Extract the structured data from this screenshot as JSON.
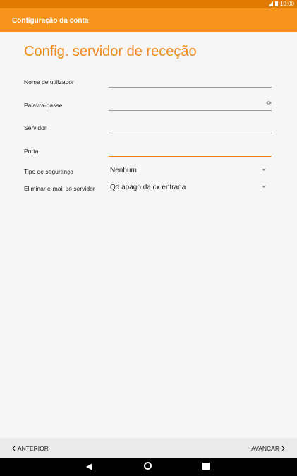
{
  "status": {
    "time": "10:00"
  },
  "app_bar": {
    "title": "Configuração da conta"
  },
  "page": {
    "heading": "Config. servidor de receção"
  },
  "form": {
    "username": {
      "label": "Nome de utilizador",
      "value": ""
    },
    "password": {
      "label": "Palavra-passe",
      "value": ""
    },
    "server": {
      "label": "Servidor",
      "value": ""
    },
    "port": {
      "label": "Porta",
      "value": ""
    },
    "security": {
      "label": "Tipo de segurança",
      "value": "Nenhum"
    },
    "delete_email": {
      "label": "Eliminar e-mail do servidor",
      "value": "Qd apago da cx entrada"
    }
  },
  "footer": {
    "prev_label": "ANTERIOR",
    "next_label": "AVANÇAR"
  },
  "colors": {
    "accent": "#f7941d",
    "heading": "#f08a1a",
    "status_bar": "#e07a00"
  }
}
